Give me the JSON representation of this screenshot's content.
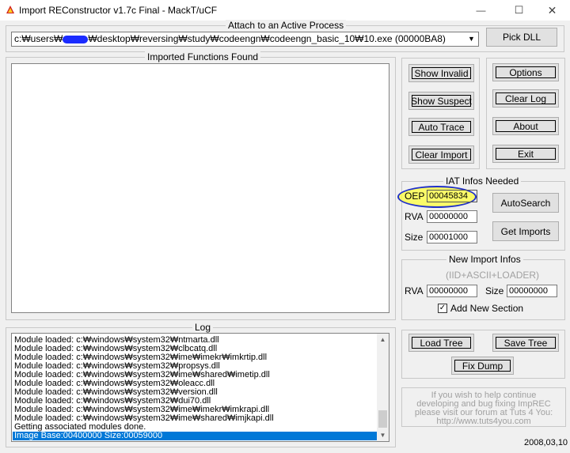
{
  "titlebar": {
    "title": "Import REConstructor v1.7c Final - MackT/uCF",
    "minimize": "—",
    "maximize": "☐",
    "close": "✕"
  },
  "attach": {
    "label": "Attach to an Active Process",
    "process_prefix": "c:₩users₩",
    "process_suffix": "₩desktop₩reversing₩study₩codeengn₩codeengn_basic_10₩10.exe (00000BA8)",
    "pick_dll": "Pick DLL"
  },
  "imported": {
    "label": "Imported Functions Found"
  },
  "buttons": {
    "show_invalid": "Show Invalid",
    "show_suspect": "Show Suspect",
    "auto_trace": "Auto Trace",
    "clear_import": "Clear Import",
    "options": "Options",
    "clear_log": "Clear Log",
    "about": "About",
    "exit": "Exit"
  },
  "iat": {
    "label": "IAT Infos Needed",
    "oep_label": "OEP",
    "oep_value": "00045834",
    "rva_label": "RVA",
    "rva_value": "00000000",
    "size_label": "Size",
    "size_value": "00001000",
    "autosearch": "AutoSearch",
    "get_imports": "Get Imports"
  },
  "new_import": {
    "label": "New Import Infos",
    "sublabel": "(IID+ASCII+LOADER)",
    "rva_label": "RVA",
    "rva_value": "00000000",
    "size_label": "Size",
    "size_value": "00000000",
    "add_section_label": "Add New Section",
    "add_section_checked": true
  },
  "log": {
    "label": "Log",
    "lines": [
      "Module loaded: c:₩windows₩system32₩ntmarta.dll",
      "Module loaded: c:₩windows₩system32₩clbcatq.dll",
      "Module loaded: c:₩windows₩system32₩ime₩imekr₩imkrtip.dll",
      "Module loaded: c:₩windows₩system32₩propsys.dll",
      "Module loaded: c:₩windows₩system32₩ime₩shared₩imetip.dll",
      "Module loaded: c:₩windows₩system32₩oleacc.dll",
      "Module loaded: c:₩windows₩system32₩version.dll",
      "Module loaded: c:₩windows₩system32₩dui70.dll",
      "Module loaded: c:₩windows₩system32₩ime₩imekr₩imkrapi.dll",
      "Module loaded: c:₩windows₩system32₩ime₩shared₩imjkapi.dll",
      "Getting associated modules done.",
      "Image Base:00400000 Size:00059000"
    ],
    "selected_index": 11
  },
  "tree": {
    "load_tree": "Load Tree",
    "save_tree": "Save Tree",
    "fix_dump": "Fix Dump"
  },
  "info": {
    "lines": [
      "If you wish to help continue",
      "developing and bug fixing ImpREC",
      "please visit our forum at Tuts 4 You:",
      "http://www.tuts4you.com"
    ]
  },
  "date": "2008,03,10",
  "colors": {
    "window_bg": "#f0f0f0",
    "selection": "#0078d7",
    "oep_highlight": "#ffff3c",
    "oep_circle": "#2030c8"
  }
}
